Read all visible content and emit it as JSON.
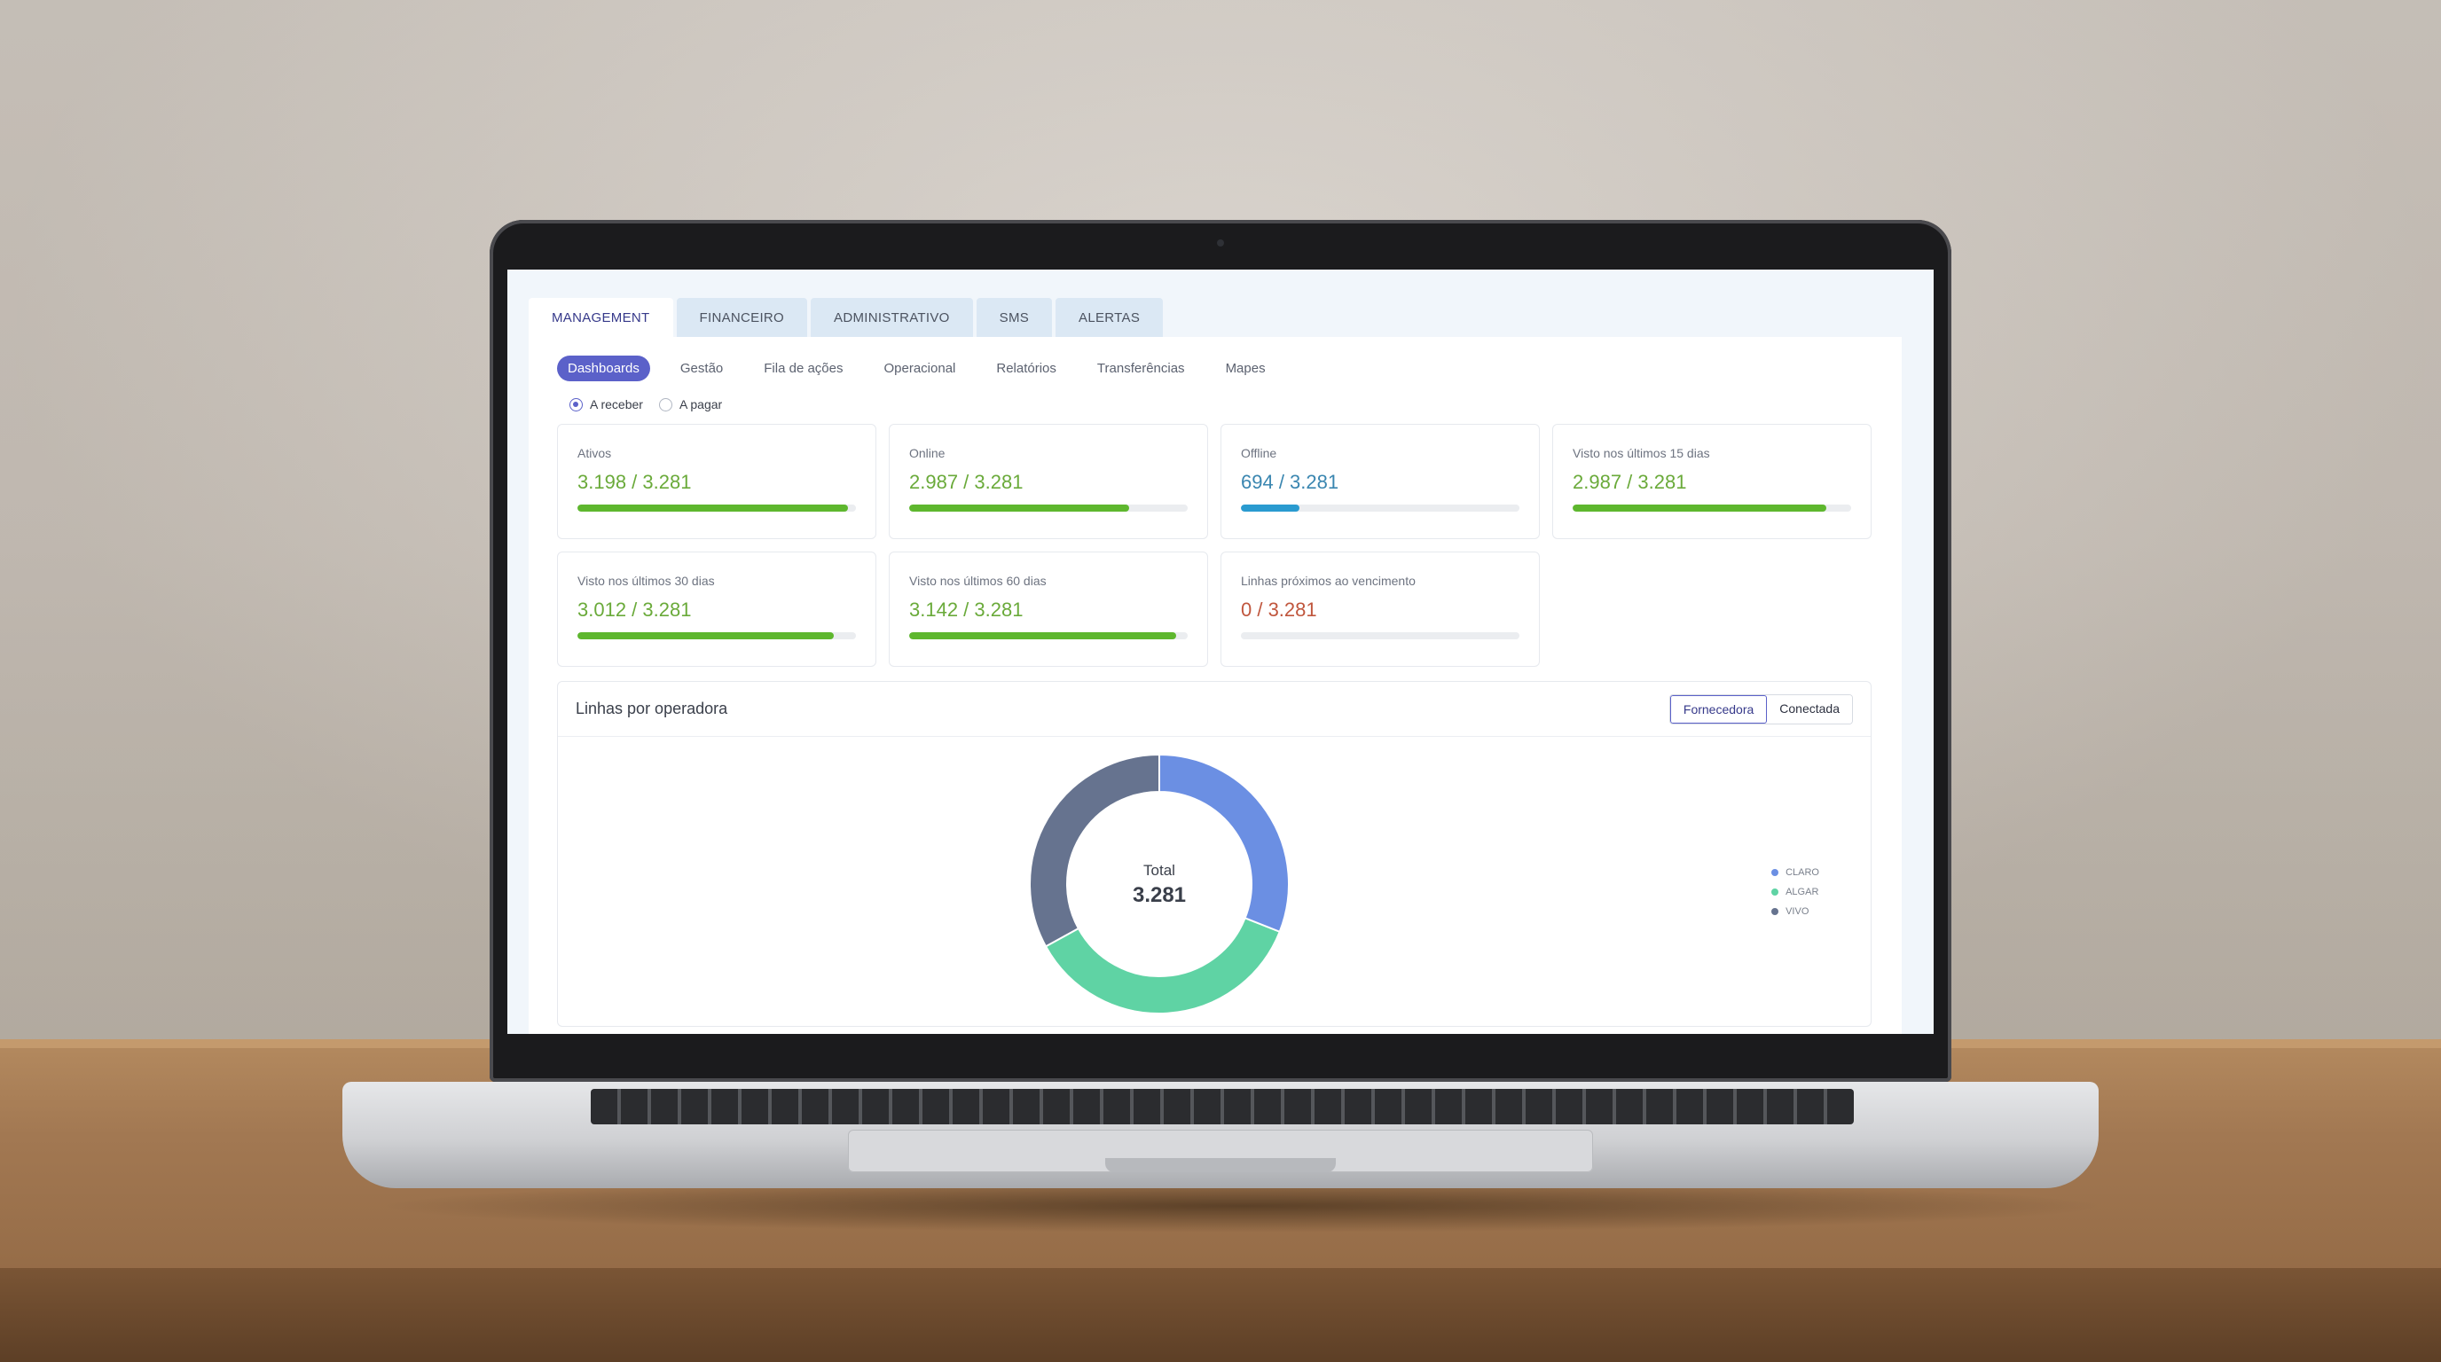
{
  "top_tabs": [
    "MANAGEMENT",
    "FINANCEIRO",
    "ADMINISTRATIVO",
    "SMS",
    "ALERTAS"
  ],
  "sub_nav": [
    "Dashboards",
    "Gestão",
    "Fila de ações",
    "Operacional",
    "Relatórios",
    "Transferências",
    "Mapes"
  ],
  "radios": {
    "receber": "A receber",
    "pagar": "A pagar"
  },
  "cards": [
    {
      "label": "Ativos",
      "value": "3.198 / 3.281",
      "progress": 0.97,
      "color": "#6aaa3a",
      "bar": "#5eb72e"
    },
    {
      "label": "Online",
      "value": "2.987 / 3.281",
      "progress": 0.79,
      "color": "#6aaa3a",
      "bar": "#5eb72e"
    },
    {
      "label": "Offline",
      "value": "694 / 3.281",
      "progress": 0.21,
      "color": "#3a86b0",
      "bar": "#2a9bd0"
    },
    {
      "label": "Visto nos últimos 15 dias",
      "value": "2.987 / 3.281",
      "progress": 0.91,
      "color": "#6aaa3a",
      "bar": "#5eb72e"
    },
    {
      "label": "Visto nos últimos 30 dias",
      "value": "3.012 / 3.281",
      "progress": 0.92,
      "color": "#6aaa3a",
      "bar": "#5eb72e"
    },
    {
      "label": "Visto nos últimos 60 dias",
      "value": "3.142 / 3.281",
      "progress": 0.96,
      "color": "#6aaa3a",
      "bar": "#5eb72e"
    },
    {
      "label": "Linhas próximos ao vencimento",
      "value": "0 / 3.281",
      "progress": 0,
      "color": "#c0563d",
      "bar": "#c0563d"
    }
  ],
  "chart_section": {
    "title": "Linhas por operadora",
    "toggle": [
      "Fornecedora",
      "Conectada"
    ],
    "center_label": "Total",
    "center_value": "3.281"
  },
  "chart_data": {
    "type": "pie",
    "categories": [
      "CLARO",
      "ALGAR",
      "VIVO"
    ],
    "values": [
      0.31,
      0.36,
      0.33
    ],
    "colors": [
      "#6b8fe3",
      "#5fd3a4",
      "#66738f"
    ]
  }
}
